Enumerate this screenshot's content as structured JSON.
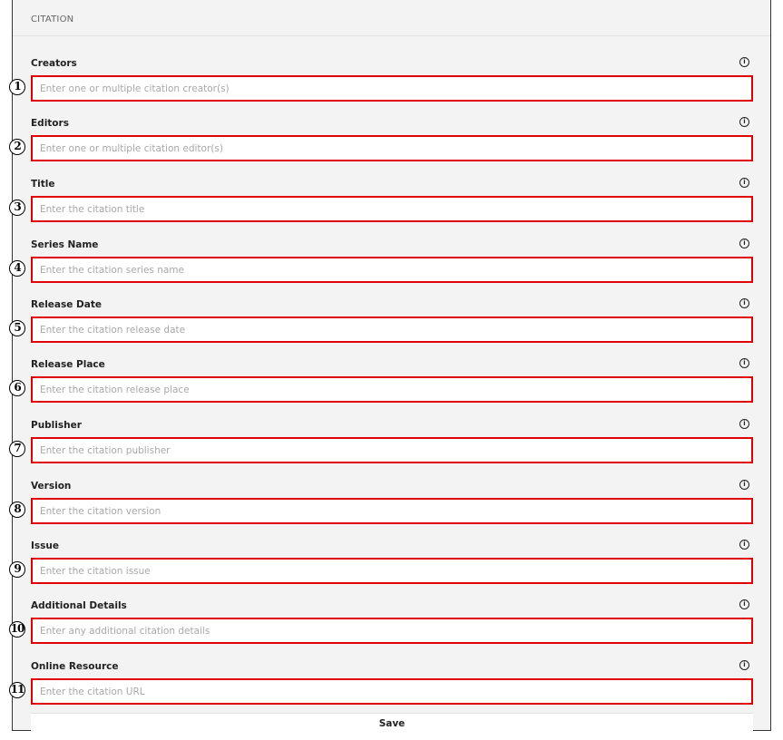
{
  "section": {
    "title": "CITATION"
  },
  "fields": [
    {
      "marker": "1",
      "label": "Creators",
      "placeholder": "Enter one or multiple citation creator(s)",
      "value": ""
    },
    {
      "marker": "2",
      "label": "Editors",
      "placeholder": "Enter one or multiple citation editor(s)",
      "value": ""
    },
    {
      "marker": "3",
      "label": "Title",
      "placeholder": "Enter the citation title",
      "value": ""
    },
    {
      "marker": "4",
      "label": "Series Name",
      "placeholder": "Enter the citation series name",
      "value": ""
    },
    {
      "marker": "5",
      "label": "Release Date",
      "placeholder": "Enter the citation release date",
      "value": ""
    },
    {
      "marker": "6",
      "label": "Release Place",
      "placeholder": "Enter the citation release place",
      "value": ""
    },
    {
      "marker": "7",
      "label": "Publisher",
      "placeholder": "Enter the citation publisher",
      "value": ""
    },
    {
      "marker": "8",
      "label": "Version",
      "placeholder": "Enter the citation version",
      "value": ""
    },
    {
      "marker": "9",
      "label": "Issue",
      "placeholder": "Enter the citation issue",
      "value": ""
    },
    {
      "marker": "10",
      "label": "Additional Details",
      "placeholder": "Enter any additional citation details",
      "value": ""
    },
    {
      "marker": "11",
      "label": "Online Resource",
      "placeholder": "Enter the citation URL",
      "value": ""
    }
  ],
  "icons": {
    "info": "info-circle-icon"
  },
  "actions": {
    "save_label": "Save"
  }
}
